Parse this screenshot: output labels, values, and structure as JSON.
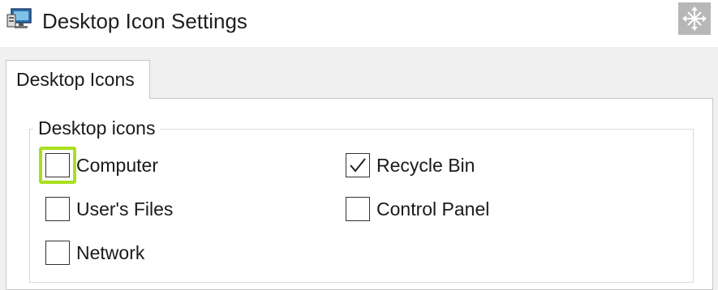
{
  "window": {
    "title": "Desktop Icon Settings",
    "app_icon": "desktop-monitor-icon",
    "move_icon": "move-arrows-icon"
  },
  "tabs": [
    {
      "label": "Desktop Icons",
      "selected": true
    }
  ],
  "group": {
    "legend": "Desktop icons",
    "checkboxes": [
      {
        "label": "Computer",
        "checked": false,
        "focused": true
      },
      {
        "label": "User's Files",
        "checked": false,
        "focused": false
      },
      {
        "label": "Network",
        "checked": false,
        "focused": false
      },
      {
        "label": "Recycle Bin",
        "checked": true,
        "focused": false
      },
      {
        "label": "Control Panel",
        "checked": false,
        "focused": false
      }
    ]
  },
  "colors": {
    "focus_highlight": "#a9e01e",
    "dialog_background": "#f0f0f0",
    "move_button": "#b7b7b7"
  }
}
